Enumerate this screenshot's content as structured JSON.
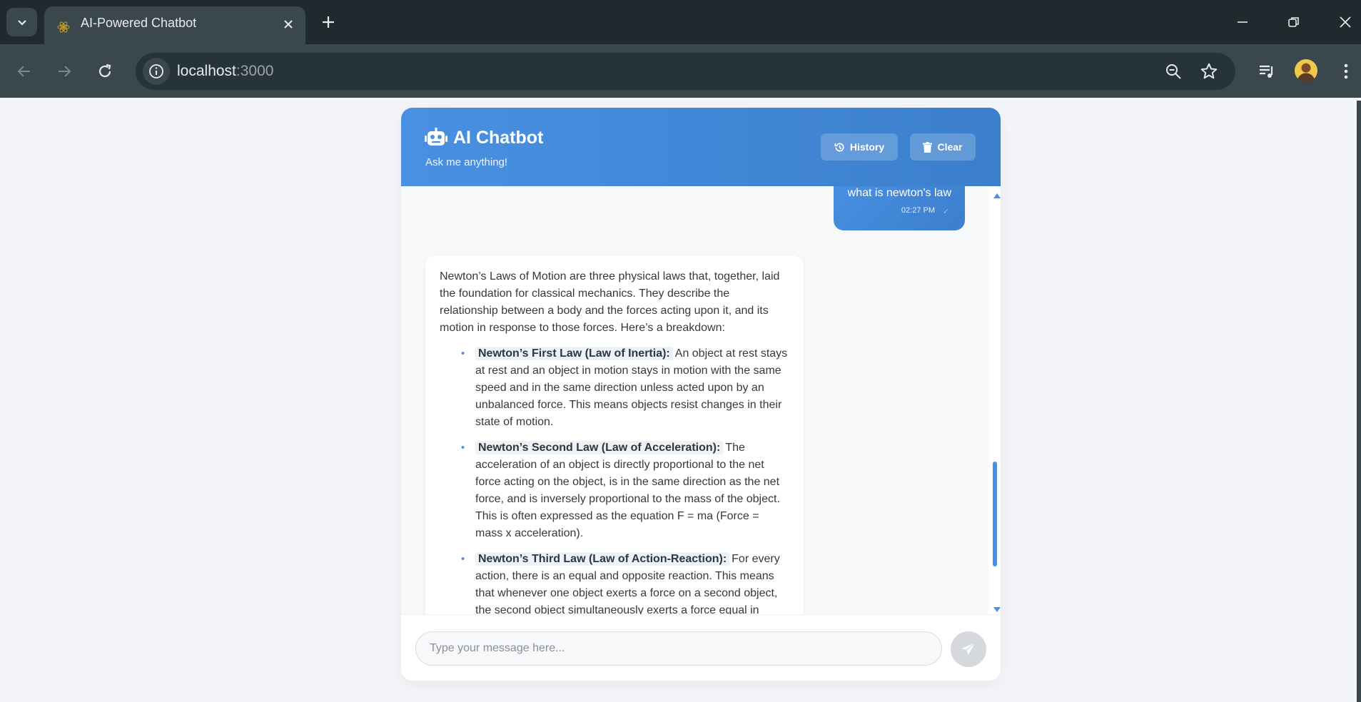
{
  "browser": {
    "tab_title": "AI-Powered Chatbot",
    "url_host": "localhost",
    "url_port": ":3000",
    "icons": {
      "tab_search": "chevron-down-icon",
      "favicon": "react-logo-icon",
      "tab_close": "close-icon",
      "new_tab": "plus-icon",
      "minimize": "minimize-icon",
      "restore": "restore-icon",
      "window_close": "close-icon",
      "back": "arrow-left-icon",
      "forward": "arrow-right-icon",
      "reload": "reload-icon",
      "site_info": "info-icon",
      "zoom": "zoom-out-icon",
      "bookmark": "star-icon",
      "media": "playlist-icon",
      "menu": "kebab-menu-icon"
    }
  },
  "chat": {
    "title": "AI Chatbot",
    "subtitle": "Ask me anything!",
    "history_label": "History",
    "clear_label": "Clear",
    "input_placeholder": "Type your message here...",
    "accent_color": "#4a90e2"
  },
  "messages": {
    "user": {
      "text": "what is newton's law",
      "time": "02:27 PM",
      "status": "✓"
    },
    "bot": {
      "intro": "Newton’s Laws of Motion are three physical laws that, together, laid the foundation for classical mechanics. They describe the relationship between a body and the forces acting upon it, and its motion in response to those forces. Here’s a breakdown:",
      "laws": [
        {
          "name": "Newton’s First Law (Law of Inertia):",
          "text": "An object at rest stays at rest and an object in motion stays in motion with the same speed and in the same direction unless acted upon by an unbalanced force. This means objects resist changes in their state of motion."
        },
        {
          "name": "Newton’s Second Law (Law of Acceleration):",
          "text": "The acceleration of an object is directly proportional to the net force acting on the object, is in the same direction as the net force, and is inversely proportional to the mass of the object. This is often expressed as the equation F = ma (Force = mass x acceleration)."
        },
        {
          "name": "Newton’s Third Law (Law of Action-Reaction):",
          "text": "For every action, there is an equal and opposite reaction. This means that whenever one object exerts a force on a second object, the second object simultaneously exerts a force equal in"
        }
      ]
    }
  }
}
